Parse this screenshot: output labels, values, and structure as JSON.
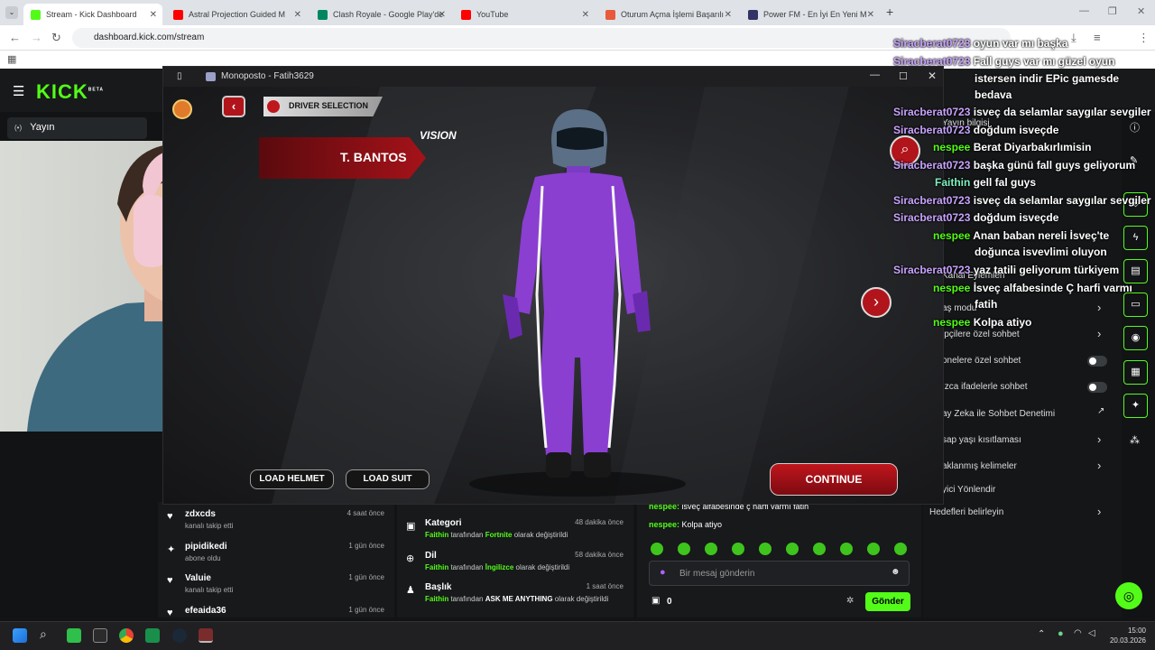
{
  "browser": {
    "tabs": [
      {
        "label": "Stream - Kick Dashboard",
        "fav": "#53fc18"
      },
      {
        "label": "Astral Projection Guided M",
        "fav": "#ff0000"
      },
      {
        "label": "Clash Royale - Google Play'de",
        "fav": "#01875f"
      },
      {
        "label": "YouTube",
        "fav": "#ff0000"
      },
      {
        "label": "Oturum Açma İşlemi Başarılı",
        "fav": "#e85a3a"
      },
      {
        "label": "Power FM - En İyi En Yeni M",
        "fav": "#333366"
      }
    ],
    "url": "dashboard.kick.com/stream"
  },
  "kick": {
    "logo": "KICK",
    "logo_badge": "BETA",
    "nav_yayin": "Yayın",
    "right_panel": [
      {
        "label": "Yayın bilgisi"
      },
      {
        "label": "Kanal Eylemleri"
      },
      {
        "label": "aş modu"
      },
      {
        "label": "ipçilere özel sohbet"
      },
      {
        "label": "onelere özel sohbet"
      },
      {
        "label": "ızca ifadelerle sohbet"
      },
      {
        "label": "ay Zeka ile Sohbet Denetimi"
      },
      {
        "label": "sap yaşı kısıtlaması"
      },
      {
        "label": "aklanmış kelimeler"
      },
      {
        "label": "yici Yönlendir"
      },
      {
        "label": "Hedefleri belirleyin"
      }
    ],
    "feed": [
      {
        "name": "zdxcds",
        "sub": "kanalı takip etti",
        "time": "4 saat önce"
      },
      {
        "name": "pipidikedi",
        "sub": "abone oldu",
        "time": "1 gün önce"
      },
      {
        "name": "Valuie",
        "sub": "kanalı takip etti",
        "time": "1 gün önce"
      },
      {
        "name": "efeaida36",
        "sub": "",
        "time": "1 gün önce"
      }
    ],
    "history": [
      {
        "title": "Kategori",
        "user": "Faithin",
        "mid": "tarafından",
        "value": "Fortnite",
        "end": "olarak değiştirildi",
        "time": "48 dakika önce"
      },
      {
        "title": "Dil",
        "user": "Faithin",
        "mid": "tarafından",
        "value": "İngilizce",
        "end": "olarak değiştirildi",
        "time": "58 dakika önce"
      },
      {
        "title": "Başlık",
        "user": "Faithin",
        "mid": "tarafından",
        "value": "ASK ME ANYTHING",
        "end": "olarak değiştirildi",
        "time": "1 saat önce"
      }
    ],
    "chat_small": [
      {
        "user": "nespee:",
        "text": "isveç alfabesinde ç harfi varmı fatih"
      },
      {
        "user": "nespee:",
        "text": "Kolpa atiyo"
      }
    ],
    "message_placeholder": "Bir mesaj gönderin",
    "points": "0",
    "send": "Gönder"
  },
  "game": {
    "window_title": "Monoposto - Fatih3629",
    "section": "DRIVER SELECTION",
    "driver": "T. BANTOS",
    "suit_text": "VISION",
    "load_helmet": "LOAD HELMET",
    "load_suit": "LOAD SUIT",
    "continue": "CONTINUE"
  },
  "overlay": [
    {
      "user": "Siracberat0723",
      "text": "oyun var mı başka",
      "cls": "s"
    },
    {
      "user": "Siracberat0723",
      "text": "Fall guys var mı güzel oyun",
      "cls": "s"
    },
    {
      "user": "",
      "text": "istersen indir EPic gamesde",
      "cls": ""
    },
    {
      "user": "",
      "text": "bedava",
      "cls": ""
    },
    {
      "user": "Siracberat0723",
      "text": "isveç da selamlar saygılar sevgiler",
      "cls": "s"
    },
    {
      "user": "Siracberat0723",
      "text": "doğdum isveçde",
      "cls": "s"
    },
    {
      "user": "nespee",
      "text": "Berat Diyarbakırlımisin",
      "cls": "n"
    },
    {
      "user": "Siracberat0723",
      "text": "başka günü fall guys geliyorum",
      "cls": "s"
    },
    {
      "user": "Faithin",
      "text": "gell fal guys",
      "cls": "f"
    },
    {
      "user": "Siracberat0723",
      "text": "isveç da selamlar saygılar sevgiler",
      "cls": "s"
    },
    {
      "user": "Siracberat0723",
      "text": "doğdum isveçde",
      "cls": "s"
    },
    {
      "user": "nespee",
      "text": "Anan baban nereli İsveç'te",
      "cls": "n"
    },
    {
      "user": "",
      "text": "doğunca isvevlimi oluyon",
      "cls": ""
    },
    {
      "user": "Siracberat0723",
      "text": "yaz tatili geliyorum türkiyem",
      "cls": "s"
    },
    {
      "user": "nespee",
      "text": "İsveç alfabesinde Ç harfi varmı",
      "cls": "n"
    },
    {
      "user": "",
      "text": "fatih",
      "cls": ""
    },
    {
      "user": "nespee",
      "text": "Kolpa atiyo",
      "cls": "n"
    }
  ],
  "taskbar": {
    "time": "15:00",
    "date": "20.03.2026"
  }
}
